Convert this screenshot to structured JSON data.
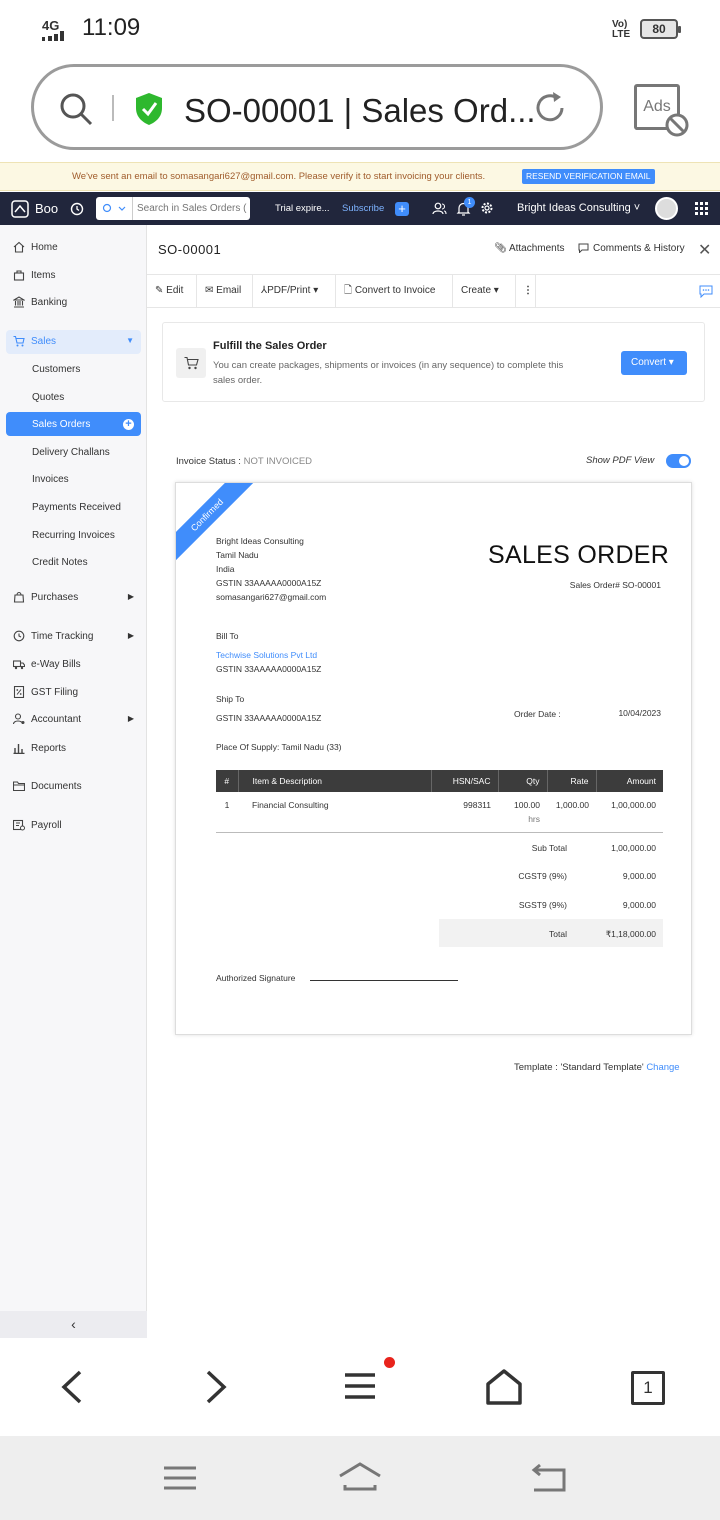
{
  "status_bar": {
    "network": "4G",
    "time": "11:09",
    "lte": "Vo) LTE",
    "battery": "80"
  },
  "browser": {
    "url_title": "SO-00001 | Sales Ord...",
    "ads_label": "Ads"
  },
  "banner": {
    "message": "We've sent an email to somasangari627@gmail.com. Please verify it to start invoicing your clients.",
    "button": "RESEND VERIFICATION EMAIL"
  },
  "topnav": {
    "org_short": "Boo",
    "search_placeholder": "Search in Sales Orders ( / )",
    "trial": "Trial expire...",
    "subscribe": "Subscribe",
    "notif_count": "1",
    "org_name": "Bright Ideas Consulting"
  },
  "sidebar": {
    "home": "Home",
    "items": "Items",
    "banking": "Banking",
    "sales": "Sales",
    "customers": "Customers",
    "quotes": "Quotes",
    "sales_orders": "Sales Orders",
    "delivery_challans": "Delivery Challans",
    "invoices": "Invoices",
    "payments_received": "Payments Received",
    "recurring_invoices": "Recurring Invoices",
    "credit_notes": "Credit Notes",
    "purchases": "Purchases",
    "time_tracking": "Time Tracking",
    "eway_bills": "e-Way Bills",
    "gst_filing": "GST Filing",
    "accountant": "Accountant",
    "reports": "Reports",
    "documents": "Documents",
    "payroll": "Payroll"
  },
  "header": {
    "title": "SO-00001",
    "attachments": "Attachments",
    "comments": "Comments & History"
  },
  "toolbar": {
    "edit": "Edit",
    "email": "Email",
    "pdf_print": "PDF/Print",
    "convert_invoice": "Convert to Invoice",
    "create": "Create"
  },
  "fulfil": {
    "title": "Fulfill the Sales Order",
    "desc": "You can create packages, shipments or invoices (in any sequence) to complete this sales order.",
    "button": "Convert"
  },
  "invoice_status": {
    "label": "Invoice Status :",
    "value": "NOT INVOICED"
  },
  "show_pdf_view": "Show PDF View",
  "document": {
    "ribbon": "Confirmed",
    "heading": "SALES ORDER",
    "number": "Sales Order# SO-00001",
    "company": {
      "name": "Bright Ideas Consulting",
      "state": "Tamil Nadu",
      "country": "India",
      "gstin": "GSTIN 33AAAAA0000A15Z",
      "email": "somasangari627@gmail.com"
    },
    "bill_to_label": "Bill To",
    "bill_to_name": "Techwise Solutions Pvt Ltd",
    "bill_to_gstin": "GSTIN 33AAAAA0000A15Z",
    "ship_to_label": "Ship To",
    "ship_to_gstin": "GSTIN 33AAAAA0000A15Z",
    "order_date_label": "Order Date :",
    "order_date": "10/04/2023",
    "place_of_supply": "Place Of Supply: Tamil Nadu (33)",
    "table_headers": [
      "#",
      "Item & Description",
      "HSN/SAC",
      "Qty",
      "Rate",
      "Amount"
    ],
    "rows": [
      {
        "no": "1",
        "item": "Financial Consulting",
        "hsn": "998311",
        "qty": "100.00",
        "unit": "hrs",
        "rate": "1,000.00",
        "amount": "1,00,000.00"
      }
    ],
    "sub_total_label": "Sub Total",
    "sub_total": "1,00,000.00",
    "cgst_label": "CGST9 (9%)",
    "cgst": "9,000.00",
    "sgst_label": "SGST9 (9%)",
    "sgst": "9,000.00",
    "total_label": "Total",
    "total": "₹1,18,000.00",
    "signature_label": "Authorized Signature"
  },
  "template": {
    "label": "Template : 'Standard Template'",
    "change": "Change"
  },
  "browser_nav": {
    "tab_count": "1"
  }
}
